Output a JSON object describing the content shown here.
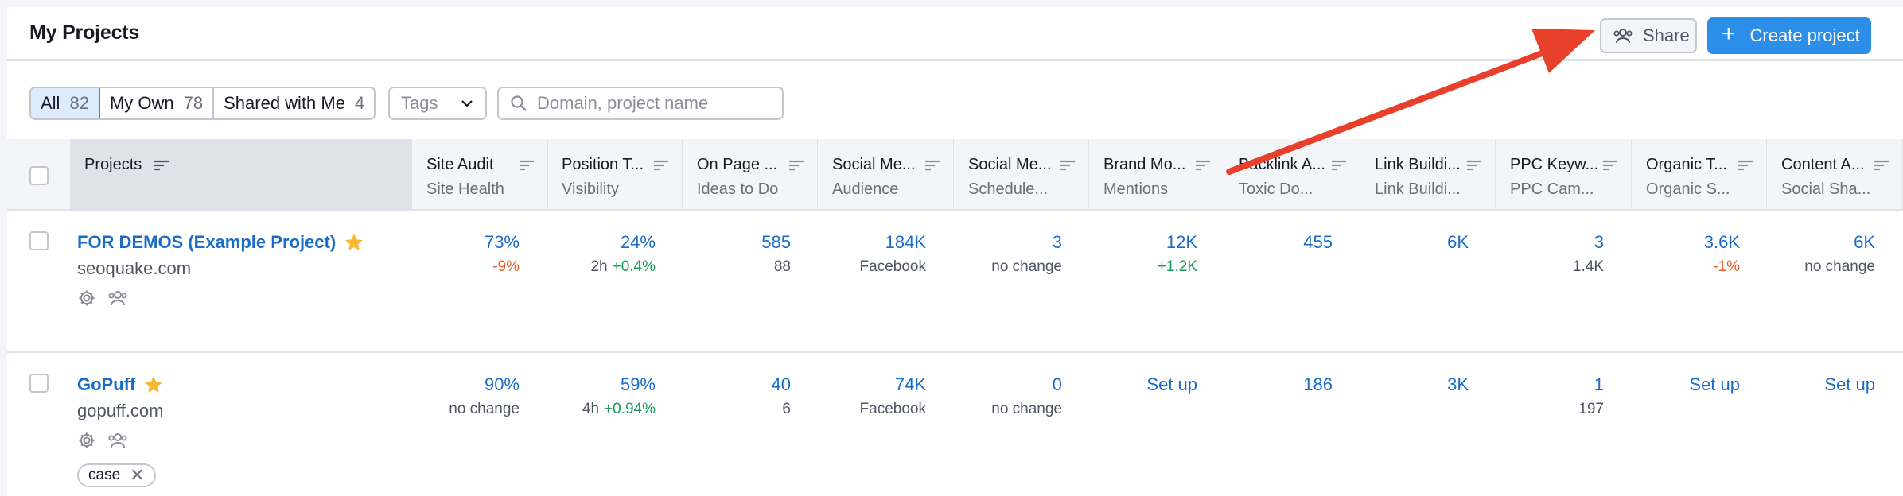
{
  "header": {
    "title": "My Projects",
    "share_label": "Share",
    "create_label": "Create project"
  },
  "filters": {
    "segments": [
      {
        "label": "All",
        "count": "82"
      },
      {
        "label": "My Own",
        "count": "78"
      },
      {
        "label": "Shared with Me",
        "count": "4"
      }
    ],
    "tags_placeholder": "Tags",
    "search_placeholder": "Domain, project name"
  },
  "table": {
    "columns": [
      {
        "title": "Projects",
        "sub": ""
      },
      {
        "title": "Site Audit",
        "sub": "Site Health"
      },
      {
        "title": "Position T...",
        "sub": "Visibility"
      },
      {
        "title": "On Page ...",
        "sub": "Ideas to Do"
      },
      {
        "title": "Social Me...",
        "sub": "Audience"
      },
      {
        "title": "Social Me...",
        "sub": "Schedule..."
      },
      {
        "title": "Brand Mo...",
        "sub": "Mentions"
      },
      {
        "title": "Backlink A...",
        "sub": "Toxic Do..."
      },
      {
        "title": "Link Buildi...",
        "sub": "Link Buildi..."
      },
      {
        "title": "PPC Keyw...",
        "sub": "PPC Cam..."
      },
      {
        "title": "Organic T...",
        "sub": "Organic S..."
      },
      {
        "title": "Content A...",
        "sub": "Social Sha..."
      }
    ],
    "rows": [
      {
        "name": "FOR DEMOS (Example Project)",
        "domain": "seoquake.com",
        "tag": "",
        "cells": [
          {
            "value": "73%",
            "sub": "",
            "delta": "-9%"
          },
          {
            "value": "24%",
            "sub": "2h",
            "delta": "+0.4%"
          },
          {
            "value": "585",
            "sub": "88",
            "delta": ""
          },
          {
            "value": "184K",
            "sub": "Facebook",
            "delta": ""
          },
          {
            "value": "3",
            "sub": "no change",
            "delta": ""
          },
          {
            "value": "12K",
            "sub": "",
            "delta": "+1.2K"
          },
          {
            "value": "455",
            "sub": "",
            "delta": ""
          },
          {
            "value": "6K",
            "sub": "",
            "delta": ""
          },
          {
            "value": "3",
            "sub": "1.4K",
            "delta": ""
          },
          {
            "value": "3.6K",
            "sub": "",
            "delta": "-1%"
          },
          {
            "value": "6K",
            "sub": "no change",
            "delta": ""
          }
        ]
      },
      {
        "name": "GoPuff",
        "domain": "gopuff.com",
        "tag": "case",
        "cells": [
          {
            "value": "90%",
            "sub": "no change",
            "delta": ""
          },
          {
            "value": "59%",
            "sub": "4h",
            "delta": "+0.94%"
          },
          {
            "value": "40",
            "sub": "6",
            "delta": ""
          },
          {
            "value": "74K",
            "sub": "Facebook",
            "delta": ""
          },
          {
            "value": "0",
            "sub": "no change",
            "delta": ""
          },
          {
            "value": "Set up",
            "sub": "",
            "delta": ""
          },
          {
            "value": "186",
            "sub": "",
            "delta": ""
          },
          {
            "value": "3K",
            "sub": "",
            "delta": ""
          },
          {
            "value": "1",
            "sub": "197",
            "delta": ""
          },
          {
            "value": "Set up",
            "sub": "",
            "delta": ""
          },
          {
            "value": "Set up",
            "sub": "",
            "delta": ""
          }
        ]
      }
    ]
  },
  "icons": {
    "share": "users-icon",
    "create": "plus-icon",
    "tags": "chevron-down-icon",
    "search": "search-icon",
    "sort": "sort-icon",
    "favorite": "star-icon",
    "settings": "gear-icon",
    "sharing": "users-icon",
    "remove_tag": "close-icon",
    "annotation": "red-arrow-icon"
  },
  "colors": {
    "accent": "#2b8fe9",
    "link": "#1a6cc9",
    "negative": "#e35e2d",
    "positive": "#1a9b5c",
    "star": "#f5b82e",
    "annotation_arrow": "#e8402a"
  }
}
